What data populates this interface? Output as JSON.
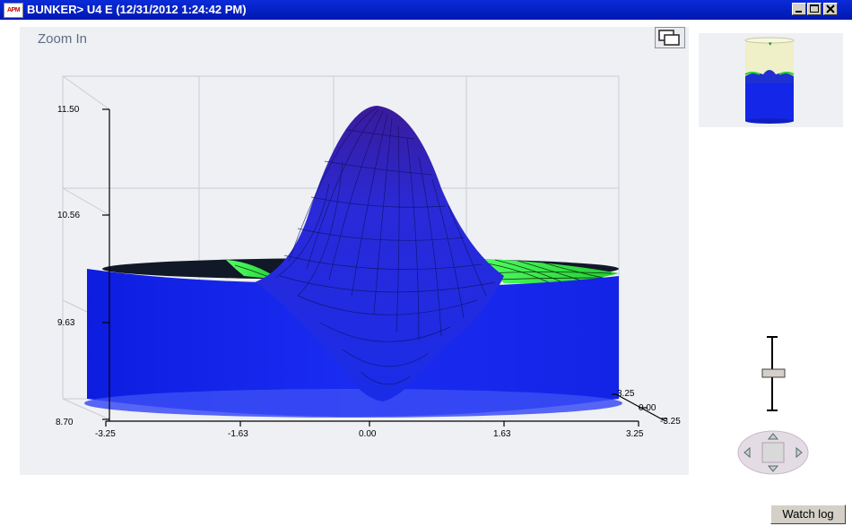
{
  "window": {
    "title": "BUNKER> U4 E (12/31/2012 1:24:42 PM)",
    "logo_text": "APM"
  },
  "toolbar": {
    "zoom_label": "Zoom In"
  },
  "chart_data": {
    "type": "surface",
    "z_ticks": [
      "11.50",
      "10.56",
      "9.63",
      "8.70"
    ],
    "x_ticks": [
      "-3.25",
      "-1.63",
      "0.00",
      "1.63",
      "3.25"
    ],
    "depth_ticks": [
      "3.25",
      "0.00",
      "-3.25"
    ],
    "z_range": [
      8.7,
      11.5
    ],
    "x_range": [
      -3.25,
      3.25
    ],
    "colors": {
      "surface": "#1f2fe0",
      "inner": "#33ff33",
      "peak": "#3a1fa8",
      "wall": "#1526f0"
    }
  },
  "buttons": {
    "watch_log": "Watch log"
  }
}
